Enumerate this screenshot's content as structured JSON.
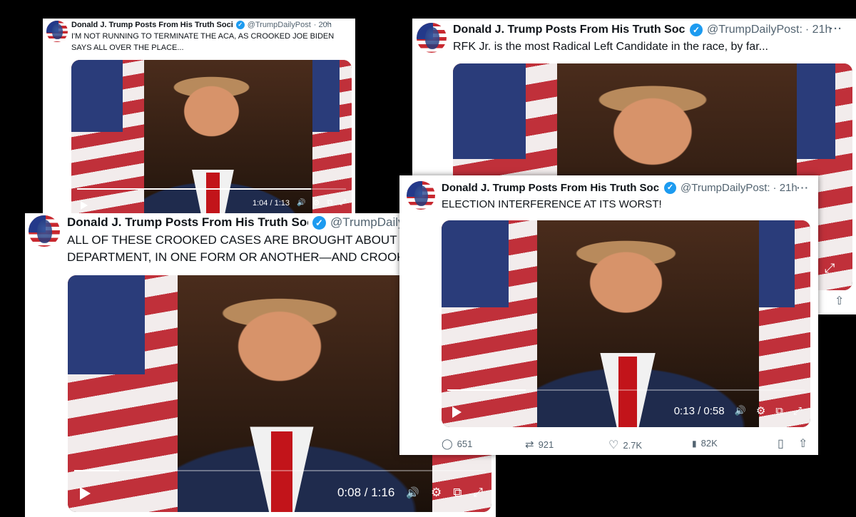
{
  "posts": [
    {
      "name": "Donald J. Trump Posts From His Truth Soci",
      "handle": "@TrumpDailyPost",
      "time": "· 20h",
      "more": "···",
      "lines": [
        "I'M NOT RUNNING TO TERMINATE THE ACA, AS CROOKED JOE BIDEN",
        "SAYS ALL OVER THE PLACE..."
      ],
      "video": {
        "time": "1:04 / 1:13",
        "progress": 0.87
      }
    },
    {
      "name": "Donald J. Trump Posts From His Truth Soci",
      "handle": "@TrumpDailyPost:",
      "time": "· 21h",
      "more": "···",
      "lines": [
        "RFK Jr. is the most Radical Left Candidate in the race, by far..."
      ]
    },
    {
      "name": "Donald J. Trump Posts From His Truth Soc",
      "handle": "@TrumpDaily",
      "lines": [
        "ALL OF THESE CROOKED CASES ARE BROUGHT ABOUT BY",
        "DEPARTMENT, IN ONE FORM OR ANOTHER—AND CROOKE"
      ],
      "video": {
        "time": "0:08 / 1:16",
        "progress": 0.11
      }
    },
    {
      "name": "Donald J. Trump Posts From His Truth Soci",
      "handle": "@TrumpDailyPost:",
      "time": "· 21h",
      "more": "···",
      "lines": [
        "ELECTION INTERFERENCE AT ITS WORST!"
      ],
      "video": {
        "time": "0:13 / 0:58",
        "progress": 0.22
      },
      "stats": {
        "replies": "651",
        "reposts": "921",
        "likes": "2.7K",
        "views": "82K"
      }
    }
  ],
  "icons": {
    "verified": "✓",
    "volume": "🔊",
    "settings": "⚙",
    "pip": "⧉",
    "fullscreen": "⤢",
    "reply": "◯",
    "repost": "⇄",
    "like": "♡",
    "views": "▮",
    "bookmark": "▯",
    "share": "⇧"
  }
}
